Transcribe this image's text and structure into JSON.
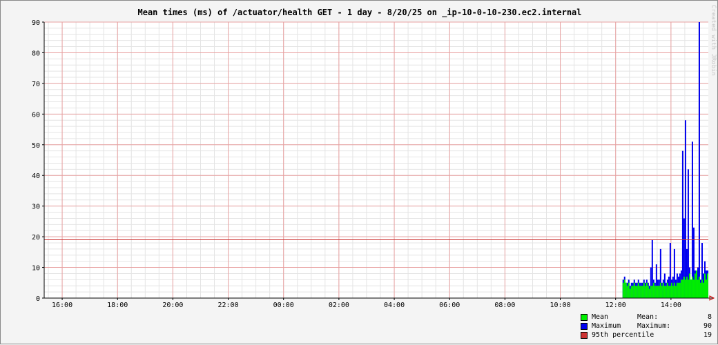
{
  "chart_data": {
    "type": "area",
    "title": "Mean times (ms) of /actuator/health GET - 1 day - 8/20/25 on _ip-10-0-10-230.ec2.internal",
    "watermark": "Created with JRobin",
    "x_ticks": [
      "16:00",
      "18:00",
      "20:00",
      "22:00",
      "00:00",
      "02:00",
      "04:00",
      "06:00",
      "08:00",
      "10:00",
      "12:00",
      "14:00"
    ],
    "x_range_hours": [
      15.35,
      39.35
    ],
    "ylim": [
      0,
      90
    ],
    "y_ticks": [
      0,
      10,
      20,
      30,
      40,
      50,
      60,
      70,
      80,
      90
    ],
    "grid": true,
    "legend_placement": "bottom-right",
    "hline": {
      "name": "95th percentile",
      "value": 19
    },
    "series": [
      {
        "name": "Mean",
        "color": "#00ee00",
        "x": [
          36.25,
          36.3,
          36.35,
          36.4,
          36.45,
          36.5,
          36.55,
          36.6,
          36.65,
          36.7,
          36.75,
          36.8,
          36.85,
          36.9,
          36.95,
          37.0,
          37.05,
          37.1,
          37.15,
          37.2,
          37.25,
          37.3,
          37.35,
          37.4,
          37.45,
          37.5,
          37.55,
          37.6,
          37.65,
          37.7,
          37.75,
          37.8,
          37.85,
          37.9,
          37.95,
          38.0,
          38.05,
          38.1,
          38.15,
          38.2,
          38.25,
          38.3,
          38.35,
          38.4,
          38.45,
          38.5,
          38.55,
          38.6,
          38.65,
          38.7,
          38.75,
          38.8,
          38.85,
          38.9,
          38.95,
          39.0,
          39.05,
          39.1,
          39.15,
          39.2,
          39.25,
          39.3
        ],
        "values": [
          5,
          6,
          5,
          4,
          5,
          3,
          4,
          4,
          5,
          4,
          4,
          5,
          4,
          4,
          4,
          5,
          4,
          5,
          4,
          3,
          4,
          4,
          5,
          4,
          4,
          4,
          4,
          5,
          4,
          5,
          4,
          4,
          5,
          4,
          4,
          5,
          4,
          5,
          4,
          5,
          5,
          5,
          6,
          6,
          7,
          6,
          7,
          6,
          8,
          6,
          7,
          6,
          8,
          9,
          6,
          7,
          5,
          6,
          5,
          8,
          6,
          8
        ]
      },
      {
        "name": "Maximum",
        "color": "#0000ee",
        "x": [
          36.25,
          36.3,
          36.35,
          36.4,
          36.45,
          36.5,
          36.55,
          36.6,
          36.65,
          36.7,
          36.75,
          36.8,
          36.85,
          36.9,
          36.95,
          37.0,
          37.05,
          37.1,
          37.15,
          37.2,
          37.25,
          37.3,
          37.35,
          37.4,
          37.45,
          37.5,
          37.55,
          37.6,
          37.65,
          37.7,
          37.75,
          37.8,
          37.85,
          37.9,
          37.95,
          38.0,
          38.05,
          38.1,
          38.15,
          38.2,
          38.25,
          38.3,
          38.35,
          38.4,
          38.45,
          38.5,
          38.55,
          38.6,
          38.65,
          38.7,
          38.75,
          38.8,
          38.85,
          38.9,
          38.95,
          39.0,
          39.05,
          39.1,
          39.15,
          39.2,
          39.25,
          39.3
        ],
        "values": [
          6,
          7,
          5,
          5,
          6,
          4,
          5,
          5,
          6,
          5,
          5,
          6,
          5,
          5,
          5,
          6,
          5,
          6,
          5,
          4,
          10,
          19,
          6,
          5,
          11,
          6,
          6,
          16,
          5,
          6,
          8,
          5,
          6,
          7,
          18,
          6,
          7,
          16,
          6,
          8,
          7,
          8,
          9,
          48,
          26,
          58,
          16,
          42,
          10,
          6,
          51,
          23,
          9,
          8,
          10,
          90,
          6,
          18,
          8,
          12,
          9,
          9
        ]
      }
    ]
  },
  "legend": [
    {
      "label": "Mean",
      "stat": "Mean:",
      "value": "8",
      "color": "#00ee00"
    },
    {
      "label": "Maximum",
      "stat": "Maximum:",
      "value": "90",
      "color": "#0000ee"
    },
    {
      "label": "95th percentile",
      "stat": ":",
      "value": "19",
      "color": "#cc3333"
    }
  ]
}
